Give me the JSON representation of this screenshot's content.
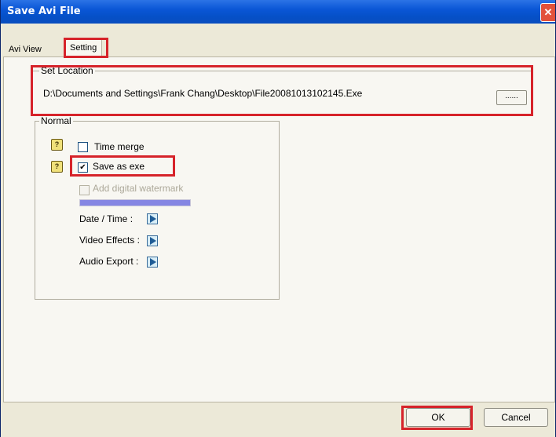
{
  "window": {
    "title": "Save Avi File",
    "close_glyph": "✕"
  },
  "tabs": [
    {
      "label": "Avi View",
      "selected": false
    },
    {
      "label": "Setting",
      "selected": true
    }
  ],
  "set_location": {
    "group_label": "Set Location",
    "path": "D:\\Documents and Settings\\Frank Chang\\Desktop\\File20081013102145.Exe",
    "browse_label": "......"
  },
  "normal": {
    "group_label": "Normal",
    "options": [
      {
        "label": "Time merge",
        "checked": false,
        "enabled": true,
        "has_help": true
      },
      {
        "label": "Save as exe",
        "checked": true,
        "enabled": true,
        "has_help": true
      },
      {
        "label": "Add digital watermark",
        "checked": false,
        "enabled": false,
        "has_help": false
      }
    ],
    "progress_fraction": 1.0,
    "expanders": [
      {
        "label": "Date / Time :"
      },
      {
        "label": "Video Effects :"
      },
      {
        "label": "Audio Export :"
      }
    ]
  },
  "help_glyph": "?",
  "check_glyph": "✔",
  "buttons": {
    "ok": "OK",
    "cancel": "Cancel"
  },
  "colors": {
    "highlight": "#d6232a",
    "title_bar": "#0a56d6",
    "progress": "#8586e3"
  }
}
